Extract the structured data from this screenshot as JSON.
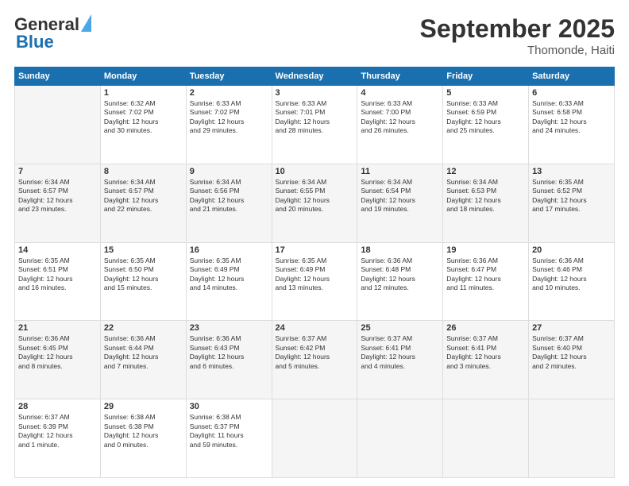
{
  "header": {
    "logo_line1": "General",
    "logo_line2": "Blue",
    "title": "September 2025",
    "subtitle": "Thomonde, Haiti"
  },
  "days_of_week": [
    "Sunday",
    "Monday",
    "Tuesday",
    "Wednesday",
    "Thursday",
    "Friday",
    "Saturday"
  ],
  "weeks": [
    [
      {
        "day": "",
        "empty": true
      },
      {
        "day": "1",
        "sunrise": "6:32 AM",
        "sunset": "7:02 PM",
        "daylight": "12 hours and 30 minutes."
      },
      {
        "day": "2",
        "sunrise": "6:33 AM",
        "sunset": "7:02 PM",
        "daylight": "12 hours and 29 minutes."
      },
      {
        "day": "3",
        "sunrise": "6:33 AM",
        "sunset": "7:01 PM",
        "daylight": "12 hours and 28 minutes."
      },
      {
        "day": "4",
        "sunrise": "6:33 AM",
        "sunset": "7:00 PM",
        "daylight": "12 hours and 26 minutes."
      },
      {
        "day": "5",
        "sunrise": "6:33 AM",
        "sunset": "6:59 PM",
        "daylight": "12 hours and 25 minutes."
      },
      {
        "day": "6",
        "sunrise": "6:33 AM",
        "sunset": "6:58 PM",
        "daylight": "12 hours and 24 minutes."
      }
    ],
    [
      {
        "day": "7",
        "sunrise": "6:34 AM",
        "sunset": "6:57 PM",
        "daylight": "12 hours and 23 minutes."
      },
      {
        "day": "8",
        "sunrise": "6:34 AM",
        "sunset": "6:57 PM",
        "daylight": "12 hours and 22 minutes."
      },
      {
        "day": "9",
        "sunrise": "6:34 AM",
        "sunset": "6:56 PM",
        "daylight": "12 hours and 21 minutes."
      },
      {
        "day": "10",
        "sunrise": "6:34 AM",
        "sunset": "6:55 PM",
        "daylight": "12 hours and 20 minutes."
      },
      {
        "day": "11",
        "sunrise": "6:34 AM",
        "sunset": "6:54 PM",
        "daylight": "12 hours and 19 minutes."
      },
      {
        "day": "12",
        "sunrise": "6:34 AM",
        "sunset": "6:53 PM",
        "daylight": "12 hours and 18 minutes."
      },
      {
        "day": "13",
        "sunrise": "6:35 AM",
        "sunset": "6:52 PM",
        "daylight": "12 hours and 17 minutes."
      }
    ],
    [
      {
        "day": "14",
        "sunrise": "6:35 AM",
        "sunset": "6:51 PM",
        "daylight": "12 hours and 16 minutes."
      },
      {
        "day": "15",
        "sunrise": "6:35 AM",
        "sunset": "6:50 PM",
        "daylight": "12 hours and 15 minutes."
      },
      {
        "day": "16",
        "sunrise": "6:35 AM",
        "sunset": "6:49 PM",
        "daylight": "12 hours and 14 minutes."
      },
      {
        "day": "17",
        "sunrise": "6:35 AM",
        "sunset": "6:49 PM",
        "daylight": "12 hours and 13 minutes."
      },
      {
        "day": "18",
        "sunrise": "6:36 AM",
        "sunset": "6:48 PM",
        "daylight": "12 hours and 12 minutes."
      },
      {
        "day": "19",
        "sunrise": "6:36 AM",
        "sunset": "6:47 PM",
        "daylight": "12 hours and 11 minutes."
      },
      {
        "day": "20",
        "sunrise": "6:36 AM",
        "sunset": "6:46 PM",
        "daylight": "12 hours and 10 minutes."
      }
    ],
    [
      {
        "day": "21",
        "sunrise": "6:36 AM",
        "sunset": "6:45 PM",
        "daylight": "12 hours and 8 minutes."
      },
      {
        "day": "22",
        "sunrise": "6:36 AM",
        "sunset": "6:44 PM",
        "daylight": "12 hours and 7 minutes."
      },
      {
        "day": "23",
        "sunrise": "6:36 AM",
        "sunset": "6:43 PM",
        "daylight": "12 hours and 6 minutes."
      },
      {
        "day": "24",
        "sunrise": "6:37 AM",
        "sunset": "6:42 PM",
        "daylight": "12 hours and 5 minutes."
      },
      {
        "day": "25",
        "sunrise": "6:37 AM",
        "sunset": "6:41 PM",
        "daylight": "12 hours and 4 minutes."
      },
      {
        "day": "26",
        "sunrise": "6:37 AM",
        "sunset": "6:41 PM",
        "daylight": "12 hours and 3 minutes."
      },
      {
        "day": "27",
        "sunrise": "6:37 AM",
        "sunset": "6:40 PM",
        "daylight": "12 hours and 2 minutes."
      }
    ],
    [
      {
        "day": "28",
        "sunrise": "6:37 AM",
        "sunset": "6:39 PM",
        "daylight": "12 hours and 1 minute."
      },
      {
        "day": "29",
        "sunrise": "6:38 AM",
        "sunset": "6:38 PM",
        "daylight": "12 hours and 0 minutes."
      },
      {
        "day": "30",
        "sunrise": "6:38 AM",
        "sunset": "6:37 PM",
        "daylight": "11 hours and 59 minutes."
      },
      {
        "day": "",
        "empty": true
      },
      {
        "day": "",
        "empty": true
      },
      {
        "day": "",
        "empty": true
      },
      {
        "day": "",
        "empty": true
      }
    ]
  ]
}
